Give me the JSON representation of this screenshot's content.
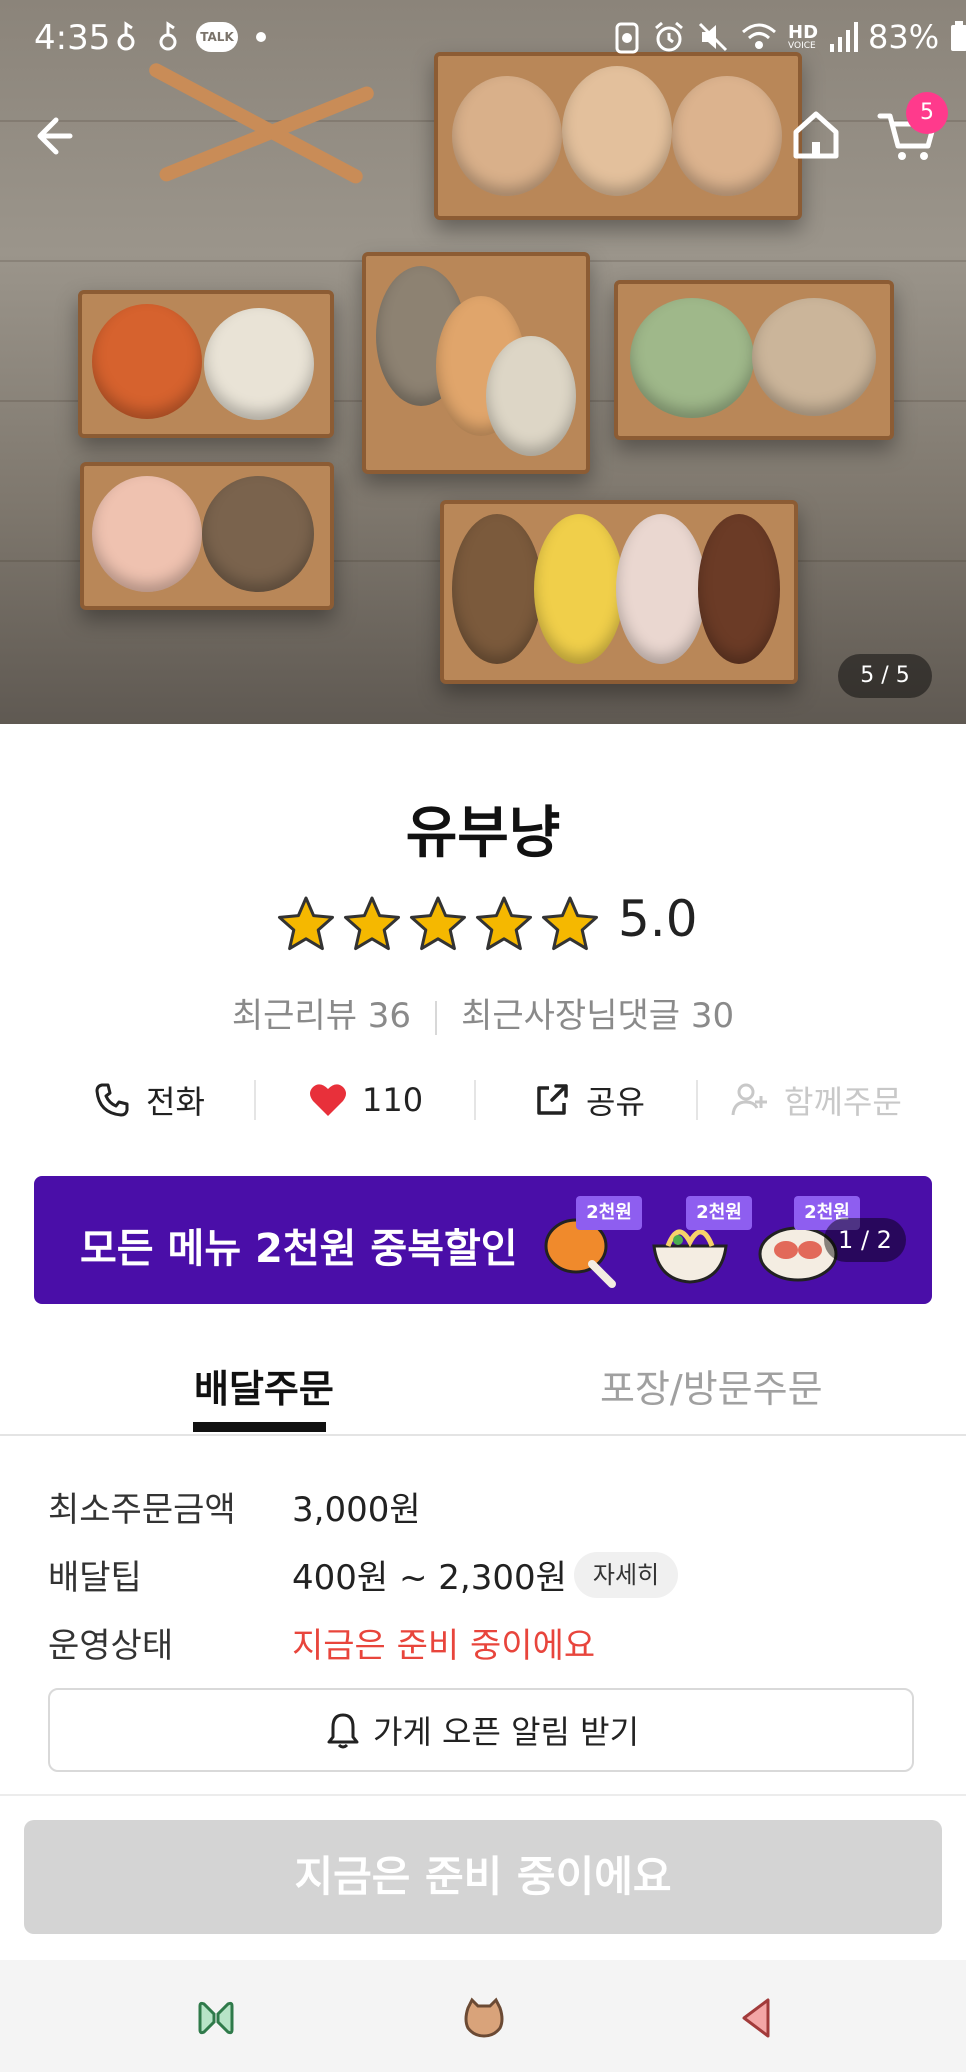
{
  "status_bar": {
    "time": "4:35",
    "left_icons": [
      "notification-icon",
      "notification-icon",
      "kakaotalk-icon",
      "dot-icon"
    ],
    "talk_label": "TALK",
    "hd_label": "HD",
    "voice_label": "VOICE",
    "battery": "83%"
  },
  "hero": {
    "page_indicator": "5 / 5",
    "cart_count": "5"
  },
  "store": {
    "name": "유부냥",
    "rating": "5.0",
    "star_count": 5,
    "recent_reviews": "최근리뷰 36",
    "owner_replies": "최근사장님댓글 30"
  },
  "actions": {
    "call": "전화",
    "likes": "110",
    "share": "공유",
    "group_order": "함께주문"
  },
  "banner": {
    "text": "모든 메뉴 2천원 중복할인",
    "tag": "2천원",
    "indicator": "1 / 2"
  },
  "tabs": {
    "delivery": "배달주문",
    "pickup": "포장/방문주문"
  },
  "info": {
    "min_order_label": "최소주문금액",
    "min_order_value": "3,000원",
    "delivery_tip_label": "배달팁",
    "delivery_tip_value": "400원 ~ 2,300원",
    "detail_chip": "자세히",
    "status_label": "운영상태",
    "status_value": "지금은 준비 중이에요"
  },
  "notify_button": "가게 오픈 알림 받기",
  "cta_button": "지금은 준비 중이에요",
  "colors": {
    "banner": "#4a0ea8",
    "status_red": "#e8453c",
    "cart_badge": "#ff3a8c",
    "star": "#f5b800",
    "heart": "#e8303a"
  }
}
